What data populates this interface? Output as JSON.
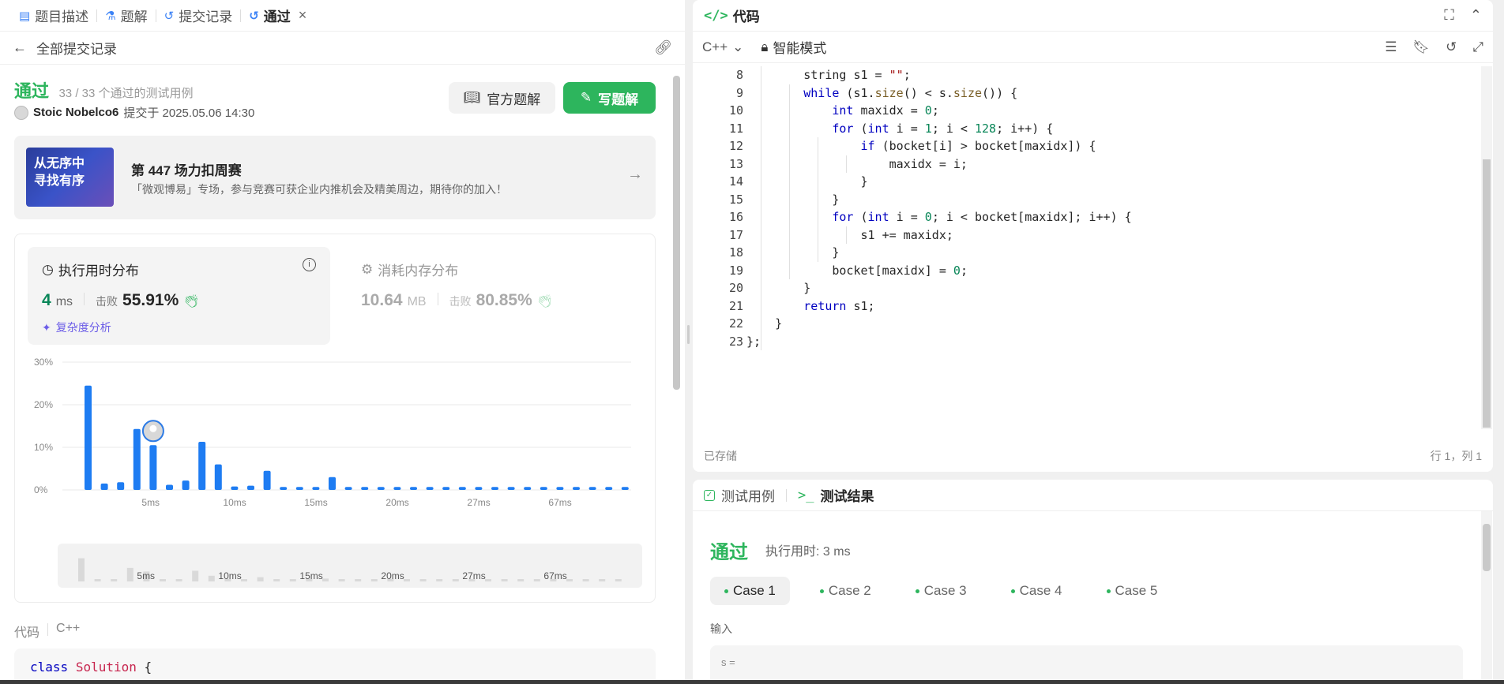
{
  "left_tabs": [
    {
      "label": "题目描述",
      "icon": "document-icon"
    },
    {
      "label": "题解",
      "icon": "flask-icon"
    },
    {
      "label": "提交记录",
      "icon": "history-icon"
    },
    {
      "label": "通过",
      "icon": "history-icon",
      "active": true
    }
  ],
  "subbar": {
    "back_label": "全部提交记录"
  },
  "submission": {
    "status": "通过",
    "cases_text": "33 / 33 个通过的测试用例",
    "author": "Stoic Nobelco6",
    "submitted_text": "提交于 2025.05.06 14:30",
    "official_btn": "官方题解",
    "write_btn": "写题解"
  },
  "banner": {
    "image_text_1": "从无序中",
    "image_text_2": "寻找有序",
    "title": "第 447 场力扣周赛",
    "desc": "「微观博易」专场，参与竞赛可获企业内推机会及精美周边，期待你的加入！"
  },
  "runtime": {
    "title": "执行用时分布",
    "value": "4",
    "unit": "ms",
    "beats_label": "击败",
    "beats_pct": "55.91%",
    "complexity": "复杂度分析"
  },
  "memory": {
    "title": "消耗内存分布",
    "value": "10.64",
    "unit": "MB",
    "beats_label": "击败",
    "beats_pct": "80.85%"
  },
  "chart_data": {
    "type": "bar",
    "ylim": [
      0,
      30
    ],
    "yticks": [
      "30%",
      "20%",
      "10%",
      "0%"
    ],
    "xtick_labels": [
      "5ms",
      "10ms",
      "15ms",
      "20ms",
      "27ms",
      "67ms"
    ],
    "values": [
      24.5,
      1.5,
      1.8,
      14.3,
      10.5,
      1.2,
      2.2,
      11.3,
      6.0,
      0.8,
      1.0,
      4.5,
      0.7,
      0.7,
      0.7,
      3.0,
      0.7,
      0.7,
      0.7,
      0.7,
      0.7,
      0.7,
      0.7,
      0.7,
      0.7,
      0.7,
      0.7,
      0.7,
      0.7,
      0.7,
      0.7,
      0.7,
      0.7,
      0.7
    ],
    "highlight_index": 4,
    "color": "#1e7cf2"
  },
  "code_label": {
    "label": "代码",
    "lang": "C++"
  },
  "code_preview": {
    "kw": "class",
    "name": "Solution",
    "brace": "{"
  },
  "editor": {
    "title": "代码",
    "lang": "C++",
    "mode": "智能模式",
    "saved": "已存储",
    "cursor": "行 1，列 1"
  },
  "code_lines": [
    {
      "n": "8",
      "html": "<span>        string s1 = </span><span class=\"str\">\"\"</span><span>;</span>"
    },
    {
      "n": "9",
      "html": "<span>        </span><span class=\"kw\">while</span><span> (s1.</span><span class=\"fn\">size</span><span>() &lt; s.</span><span class=\"fn\">size</span><span>()) {</span>"
    },
    {
      "n": "10",
      "html": "<span>            </span><span class=\"kw\">int</span><span> maxidx = </span><span class=\"num\">0</span><span>;</span>"
    },
    {
      "n": "11",
      "html": "<span>            </span><span class=\"kw\">for</span><span> (</span><span class=\"kw\">int</span><span> i = </span><span class=\"num\">1</span><span>; i &lt; </span><span class=\"num\">128</span><span>; i++) {</span>"
    },
    {
      "n": "12",
      "html": "<span>                </span><span class=\"kw\">if</span><span> (bocket[i] &gt; bocket[maxidx]) {</span>"
    },
    {
      "n": "13",
      "html": "<span>                    maxidx = i;</span>"
    },
    {
      "n": "14",
      "html": "<span>                }</span>"
    },
    {
      "n": "15",
      "html": "<span>            }</span>"
    },
    {
      "n": "16",
      "html": "<span>            </span><span class=\"kw\">for</span><span> (</span><span class=\"kw\">int</span><span> i = </span><span class=\"num\">0</span><span>; i &lt; bocket[maxidx]; i++) {</span>"
    },
    {
      "n": "17",
      "html": "<span>                s1 += maxidx;</span>"
    },
    {
      "n": "18",
      "html": "<span>            }</span>"
    },
    {
      "n": "19",
      "html": "<span>            bocket[maxidx] = </span><span class=\"num\">0</span><span>;</span>"
    },
    {
      "n": "20",
      "html": "<span>        }</span>"
    },
    {
      "n": "21",
      "html": "<span>        </span><span class=\"kw\">return</span><span> s1;</span>"
    },
    {
      "n": "22",
      "html": "<span>    }</span>"
    },
    {
      "n": "23",
      "html": "<span>};</span>"
    }
  ],
  "tests": {
    "tab_cases": "测试用例",
    "tab_result": "测试结果",
    "status": "通过",
    "time": "执行用时: 3 ms",
    "cases": [
      "Case 1",
      "Case 2",
      "Case 3",
      "Case 4",
      "Case 5"
    ],
    "input_label": "输入",
    "input_value": "s ="
  }
}
